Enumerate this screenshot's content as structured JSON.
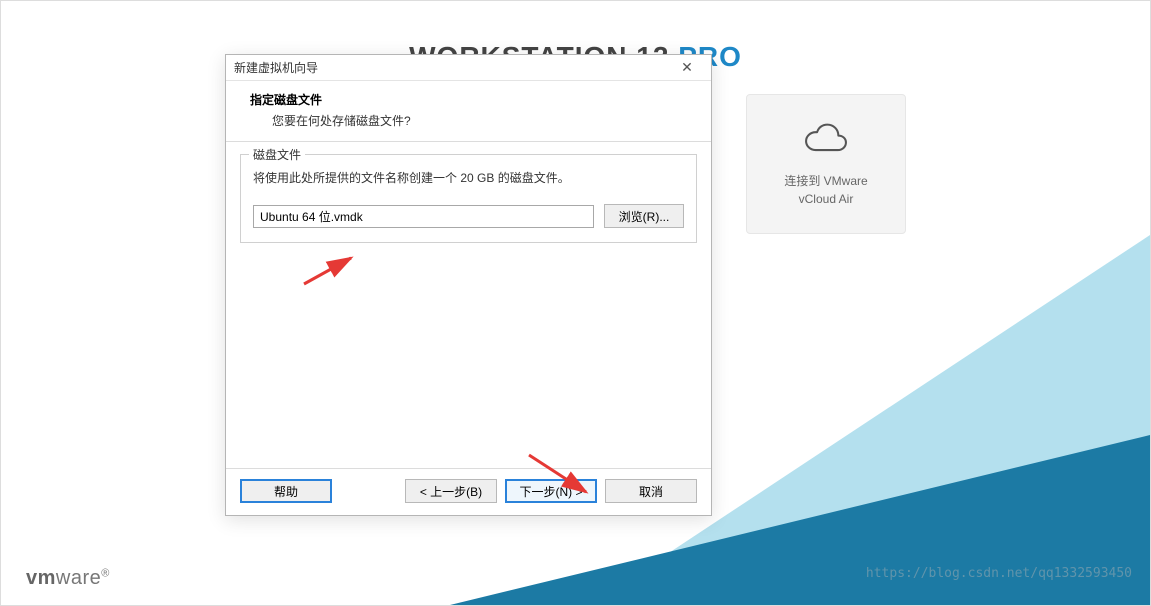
{
  "background": {
    "brand_word1": "WORKSTATION",
    "brand_suffix": " 12 ",
    "brand_word2": "PRO"
  },
  "tile": {
    "line1": "连接到 VMware",
    "line2": "vCloud Air"
  },
  "footer": {
    "logo_bold": "vm",
    "logo_rest": "ware"
  },
  "watermark": "https://blog.csdn.net/qq1332593450",
  "dialog": {
    "title": "新建虚拟机向导",
    "header_title": "指定磁盘文件",
    "header_subtitle": "您要在何处存储磁盘文件?",
    "group_label": "磁盘文件",
    "group_desc": "将使用此处所提供的文件名称创建一个 20 GB 的磁盘文件。",
    "file_value": "Ubuntu 64 位.vmdk",
    "browse_label": "浏览(R)...",
    "buttons": {
      "help": "帮助",
      "back": "< 上一步(B)",
      "next": "下一步(N) >",
      "cancel": "取消"
    }
  }
}
